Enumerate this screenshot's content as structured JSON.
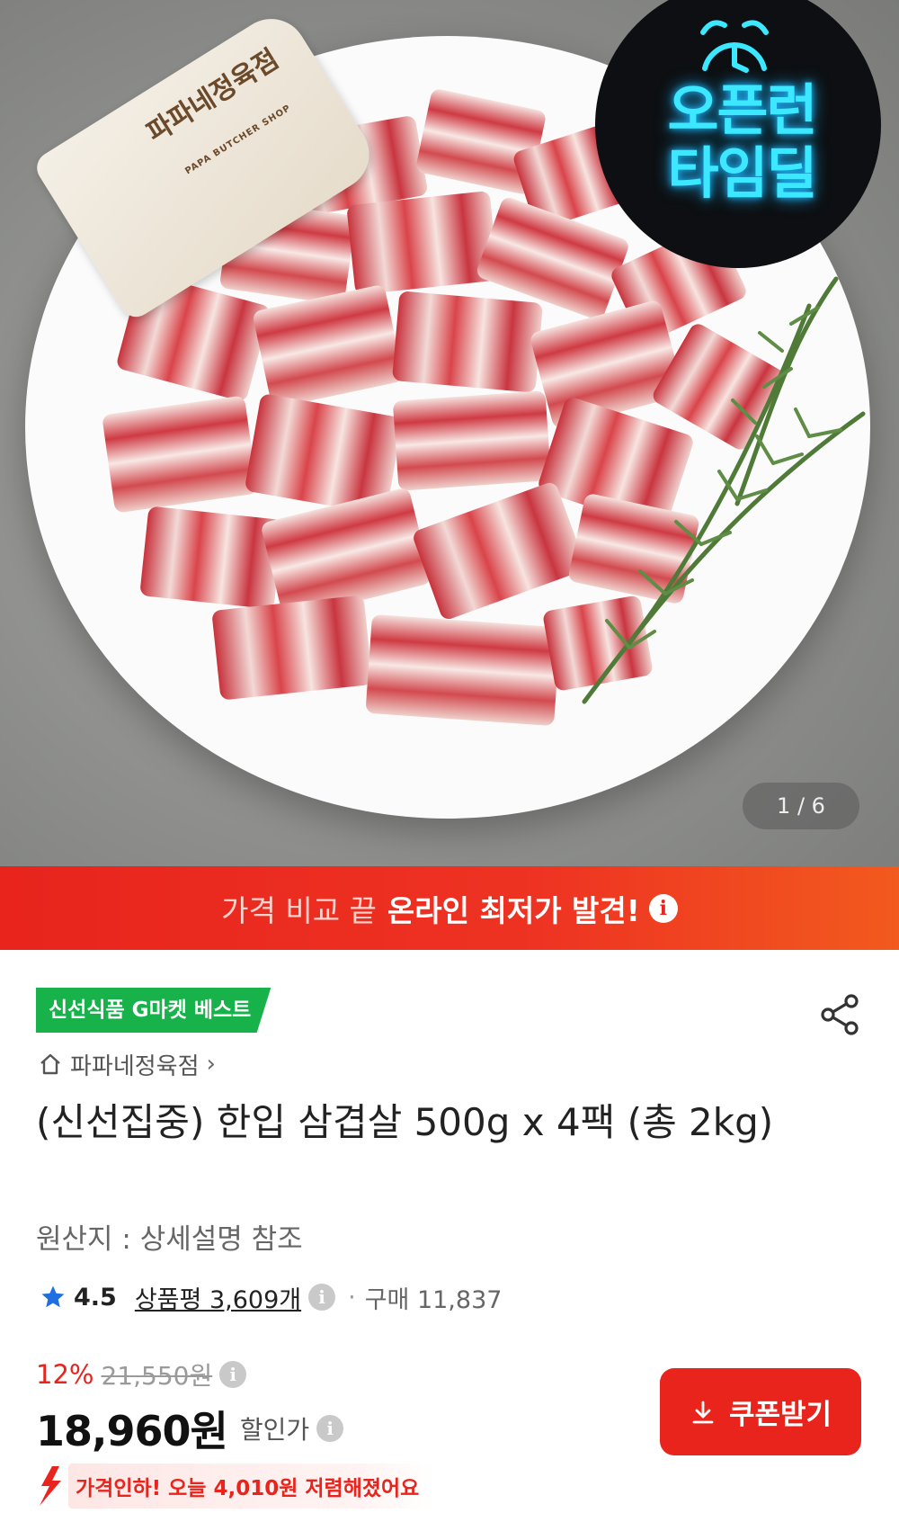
{
  "hero": {
    "paddle_brand": "파파네정육점",
    "paddle_sub": "PAPA BUTCHER SHOP",
    "badge_line1": "오픈런",
    "badge_line2": "타임딜",
    "image_counter": "1 / 6"
  },
  "promo": {
    "prefix": "가격 비교 끝",
    "highlight": "온라인 최저가 발견!",
    "info_icon": "i"
  },
  "product": {
    "best_tag": "신선식품 G마켓 베스트",
    "store_name": "파파네정육점",
    "store_chevron": "›",
    "title": "(신선집중) 한입 삼겹살 500g x 4팩 (총 2kg)",
    "origin": "원산지 : 상세설명 참조",
    "rating": "4.5",
    "reviews": "상품평 3,609개",
    "purchases": "구매 11,837",
    "separator": "·",
    "discount_pct": "12%",
    "original_price": "21,550원",
    "price": "18,960원",
    "price_label": "할인가",
    "coupon_button": "쿠폰받기",
    "price_drop_msg": "가격인하! 오늘 4,010원 저렴해졌어요"
  },
  "icons": {
    "info": "i"
  },
  "colors": {
    "accent_red": "#e8241d",
    "best_green": "#18b24a",
    "badge_cyan": "#3be8ff"
  }
}
